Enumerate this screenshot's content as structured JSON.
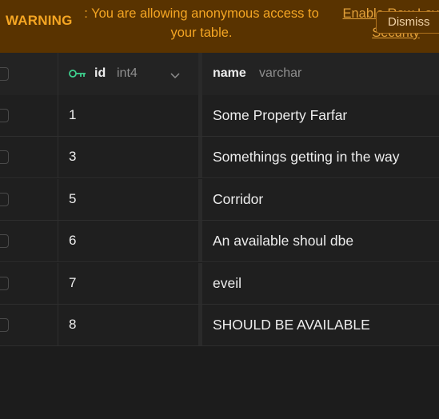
{
  "banner": {
    "label": "WARNING",
    "message": ": You are allowing anonymous access to your table.",
    "link": "Enable Row Level Security",
    "dismiss": "Dismiss"
  },
  "columns": {
    "id": {
      "name": "id",
      "type": "int4"
    },
    "name": {
      "name": "name",
      "type": "varchar"
    }
  },
  "rows": [
    {
      "id": "1",
      "name": "Some Property Farfar"
    },
    {
      "id": "3",
      "name": "Somethings getting in the way"
    },
    {
      "id": "5",
      "name": "Corridor"
    },
    {
      "id": "6",
      "name": "An available shoul dbe"
    },
    {
      "id": "7",
      "name": "eveil"
    },
    {
      "id": "8",
      "name": "SHOULD BE AVAILABLE"
    }
  ],
  "colors": {
    "banner_bg": "#593300",
    "banner_text": "#f5a623",
    "key_icon": "#3ecf8e",
    "background": "#1c1c1c"
  }
}
